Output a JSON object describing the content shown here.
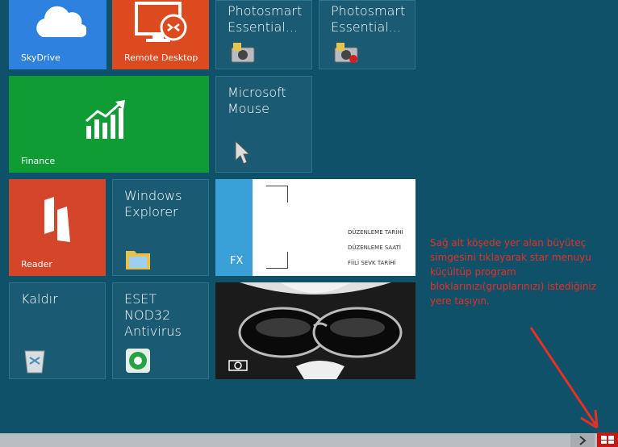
{
  "tiles": {
    "skydrive": "SkyDrive",
    "remote_desktop": "Remote Desktop",
    "photosmart1": "Photosmart Essential...",
    "photosmart2": "Photosmart Essential...",
    "finance": "Finance",
    "mouse": "Microsoft Mouse",
    "reader": "Reader",
    "explorer": "Windows Explorer",
    "kaldir": "Kaldır",
    "eset": "ESET NOD32 Antivirus"
  },
  "photo_tile": {
    "lines": [
      "DÜZENLEME TARİHİ",
      "DÜZENLEME SAATİ",
      "FİİLİ SEVK TARİHİ"
    ],
    "logo": "FX"
  },
  "annotation": "Sağ alt köşede yer alan büyüteç simgesini tıklayarak star menuyu küçültüp program bloklarınızı(gruplarınızı) istediğiniz yere taşıyın.",
  "colors": {
    "background": "#0f5168",
    "skydrive": "#2f81e0",
    "remote": "#dc4a20",
    "finance": "#109c35",
    "reader": "#d4452a",
    "annotation": "#e53027"
  },
  "icons": [
    "cloud-icon",
    "remote-desktop-icon",
    "camera-icon",
    "chart-icon",
    "cursor-icon",
    "reader-icon",
    "folder-icon",
    "recycle-bin-icon",
    "eset-icon",
    "zoom-icon"
  ]
}
